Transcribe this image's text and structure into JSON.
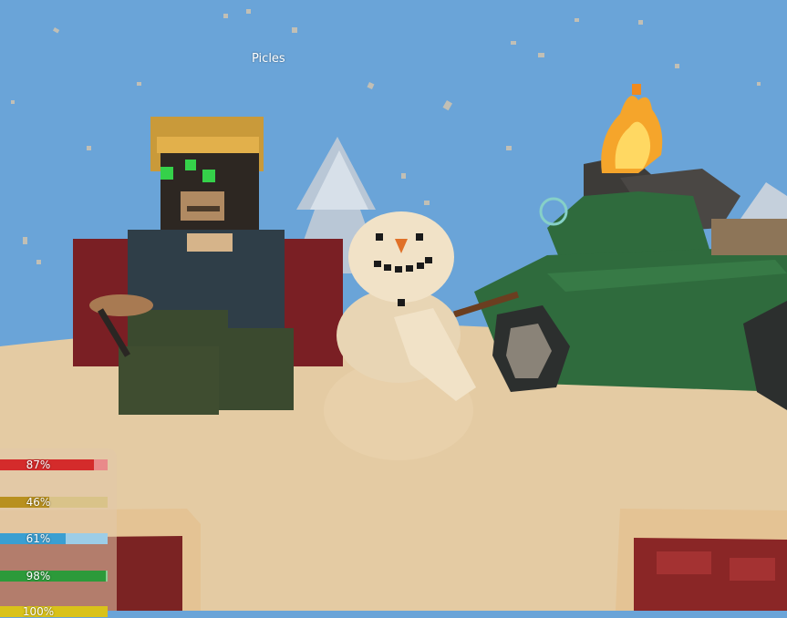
{
  "player": {
    "name": "Picles"
  },
  "hud": {
    "bars": [
      {
        "label": "87%",
        "value": 0.87,
        "fill_color": "#d42b2b",
        "rest_color": "#e98a8a"
      },
      {
        "label": "46%",
        "value": 0.46,
        "fill_color": "#b8901f",
        "rest_color": "#d9c389"
      },
      {
        "label": "61%",
        "value": 0.61,
        "fill_color": "#3a9fd2",
        "rest_color": "#9ccde7"
      },
      {
        "label": "98%",
        "value": 0.98,
        "fill_color": "#2c9a3a",
        "rest_color": "#8dcc93"
      },
      {
        "label": "100%",
        "value": 1.0,
        "fill_color": "#d9c21a",
        "rest_color": "#e9dc86"
      }
    ]
  },
  "colors": {
    "sky": "#6aa4d8",
    "sand": "#e4cba3",
    "truck": "#2f6b3d",
    "fire": "#f5a52b"
  }
}
